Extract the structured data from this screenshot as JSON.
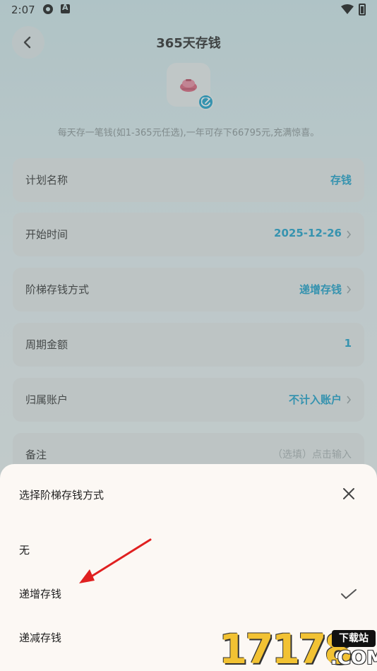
{
  "status_bar": {
    "time": "2:07"
  },
  "header": {
    "title": "365天存钱"
  },
  "description": "每天存一笔钱(如1-365元任选),一年可存下66795元,充满惊喜。",
  "form": {
    "items": [
      {
        "label": "计划名称",
        "value": "存钱"
      },
      {
        "label": "开始时间",
        "value": "2025-12-26"
      },
      {
        "label": "阶梯存钱方式",
        "value": "递增存钱"
      },
      {
        "label": "周期金额",
        "value": "1"
      },
      {
        "label": "归属账户",
        "value": "不计入账户"
      },
      {
        "label": "备注",
        "placeholder": "（选填）点击输入"
      }
    ]
  },
  "sheet": {
    "title": "选择阶梯存钱方式",
    "options": [
      {
        "label": "无",
        "selected": false
      },
      {
        "label": "递增存钱",
        "selected": true
      },
      {
        "label": "递减存钱",
        "selected": false
      }
    ]
  },
  "watermark": {
    "digits": "17178",
    "box": "下载站",
    "suffix": ".COM"
  },
  "colors": {
    "accent": "#1c9fc9",
    "annotation_arrow": "#e02020",
    "watermark_yellow": "#f2c233"
  }
}
